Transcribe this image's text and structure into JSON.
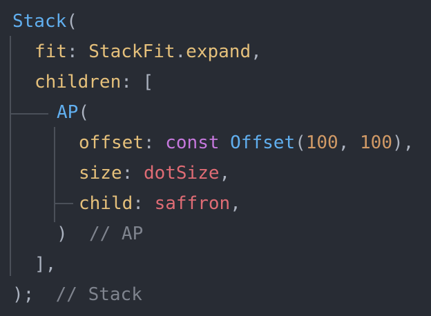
{
  "editor": {
    "lines": [
      {
        "segments": [
          {
            "text": "Stack",
            "kind": "type"
          },
          {
            "text": "(",
            "kind": "punc"
          }
        ]
      },
      {
        "segments": [
          {
            "text": "fit",
            "kind": "prop"
          },
          {
            "text": ": ",
            "kind": "punc"
          },
          {
            "text": "StackFit",
            "kind": "prop"
          },
          {
            "text": ".",
            "kind": "punc"
          },
          {
            "text": "expand",
            "kind": "prop"
          },
          {
            "text": ",",
            "kind": "punc"
          }
        ]
      },
      {
        "segments": [
          {
            "text": "children",
            "kind": "prop"
          },
          {
            "text": ": [",
            "kind": "punc"
          }
        ]
      },
      {
        "segments": [
          {
            "text": "AP",
            "kind": "type"
          },
          {
            "text": "(",
            "kind": "punc"
          }
        ]
      },
      {
        "segments": [
          {
            "text": "offset",
            "kind": "prop"
          },
          {
            "text": ": ",
            "kind": "punc"
          },
          {
            "text": "const",
            "kind": "kw"
          },
          {
            "text": " ",
            "kind": "punc"
          },
          {
            "text": "Offset",
            "kind": "type"
          },
          {
            "text": "(",
            "kind": "punc"
          },
          {
            "text": "100",
            "kind": "num"
          },
          {
            "text": ", ",
            "kind": "punc"
          },
          {
            "text": "100",
            "kind": "num"
          },
          {
            "text": "),",
            "kind": "punc"
          }
        ]
      },
      {
        "segments": [
          {
            "text": "size",
            "kind": "prop"
          },
          {
            "text": ": ",
            "kind": "punc"
          },
          {
            "text": "dotSize",
            "kind": "ident"
          },
          {
            "text": ",",
            "kind": "punc"
          }
        ]
      },
      {
        "segments": [
          {
            "text": "child",
            "kind": "prop"
          },
          {
            "text": ": ",
            "kind": "punc"
          },
          {
            "text": "saffron",
            "kind": "ident"
          },
          {
            "text": ",",
            "kind": "punc"
          }
        ]
      },
      {
        "segments": [
          {
            "text": ")",
            "kind": "punc"
          },
          {
            "text": "  ",
            "kind": "punc"
          },
          {
            "text": "// AP",
            "kind": "comment"
          }
        ]
      },
      {
        "segments": [
          {
            "text": "],",
            "kind": "punc"
          }
        ]
      },
      {
        "segments": [
          {
            "text": ");",
            "kind": "punc"
          },
          {
            "text": "  ",
            "kind": "punc"
          },
          {
            "text": "// Stack",
            "kind": "comment"
          }
        ]
      }
    ]
  },
  "colors": {
    "background": "#282c34",
    "type": "#61afef",
    "property": "#e5c07b",
    "identifier": "#e06c75",
    "keyword": "#c678dd",
    "number": "#d19a66",
    "punctuation": "#abb2bf",
    "comment": "#7f848e",
    "guide": "#4b5059"
  }
}
